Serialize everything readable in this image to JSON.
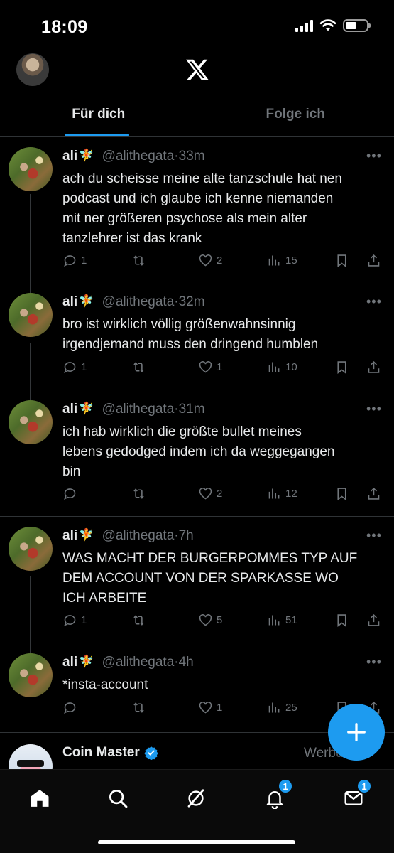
{
  "status_bar": {
    "time": "18:09"
  },
  "tabs": [
    {
      "label": "Für dich"
    },
    {
      "label": "Folge ich"
    }
  ],
  "tweets": [
    {
      "name": "ali",
      "emoji": "🧚",
      "handle": "@alithegata",
      "time": "33m",
      "lines": [
        "ach du scheisse meine alte tanzschule hat nen",
        "podcast und ich glaube ich kenne niemanden",
        "mit ner größeren psychose als mein alter",
        "tanzlehrer ist das krank"
      ],
      "replies": "1",
      "retweets": "",
      "likes": "2",
      "views": "15"
    },
    {
      "name": "ali",
      "emoji": "🧚",
      "handle": "@alithegata",
      "time": "32m",
      "lines": [
        "bro ist wirklich völlig größenwahnsinnig",
        "irgendjemand muss den dringend humblen"
      ],
      "replies": "1",
      "retweets": "",
      "likes": "1",
      "views": "10"
    },
    {
      "name": "ali",
      "emoji": "🧚",
      "handle": "@alithegata",
      "time": "31m",
      "lines": [
        "ich hab wirklich die größte bullet meines",
        "lebens gedodged indem ich da weggegangen",
        "bin"
      ],
      "replies": "",
      "retweets": "",
      "likes": "2",
      "views": "12"
    },
    {
      "name": "ali",
      "emoji": "🧚",
      "handle": "@alithegata",
      "time": "7h",
      "lines": [
        "WAS MACHT DER BURGERPOMMES TYP AUF",
        "DEM ACCOUNT VON DER SPARKASSE WO",
        "ICH ARBEITE"
      ],
      "replies": "1",
      "retweets": "",
      "likes": "5",
      "views": "51"
    },
    {
      "name": "ali",
      "emoji": "🧚",
      "handle": "@alithegata",
      "time": "4h",
      "lines": [
        "*insta-account"
      ],
      "replies": "",
      "retweets": "",
      "likes": "1",
      "views": "25"
    }
  ],
  "ad": {
    "name": "Coin Master",
    "label": "Werbung"
  },
  "nav": {
    "notifications_badge": "1",
    "messages_badge": "1"
  },
  "colors": {
    "accent": "#1d9bf0",
    "background": "#000000",
    "muted": "#71767b",
    "divider": "#2f3336"
  }
}
